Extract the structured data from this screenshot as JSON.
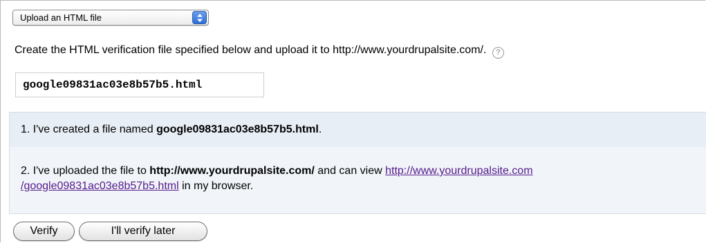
{
  "method_select": {
    "selected": "Upload an HTML file"
  },
  "instructions": {
    "text": "Create the HTML verification file specified below and upload it to http://www.yourdrupalsite.com/.",
    "help_icon": "?"
  },
  "verification_file": {
    "filename": "google09831ac03e8b57b5.html"
  },
  "steps": {
    "step1": {
      "prefix": "1. I've created a file named ",
      "filename": "google09831ac03e8b57b5.html",
      "suffix": "."
    },
    "step2": {
      "prefix": "2. I've uploaded the file to ",
      "site": "http://www.yourdrupalsite.com/",
      "middle": " and can view ",
      "link_line1": "http://www.yourdrupalsite.com",
      "link_line2": "/google09831ac03e8b57b5.html",
      "suffix": " in my browser."
    }
  },
  "buttons": {
    "verify": "Verify",
    "verify_later": "I'll verify later"
  },
  "colors": {
    "steps_background": "#f1f5f9",
    "step1_background": "#e8eef5",
    "visited_link": "#551a8b",
    "select_arrow": "#2f6fd8"
  }
}
